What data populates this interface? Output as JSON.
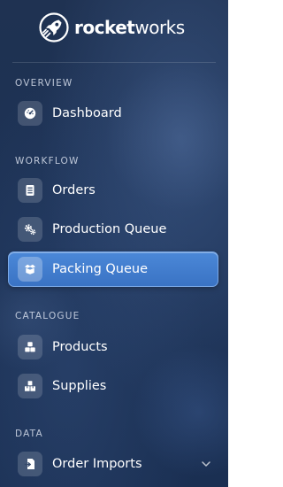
{
  "brand": {
    "name_bold": "rocket",
    "name_light": "works"
  },
  "sections": {
    "overview": {
      "label": "OVERVIEW",
      "items": [
        {
          "label": "Dashboard",
          "icon": "dashboard-gauge-icon"
        }
      ]
    },
    "workflow": {
      "label": "WORKFLOW",
      "items": [
        {
          "label": "Orders",
          "icon": "document-icon"
        },
        {
          "label": "Production Queue",
          "icon": "gears-icon"
        },
        {
          "label": "Packing Queue",
          "icon": "box-icon",
          "active": true
        }
      ]
    },
    "catalogue": {
      "label": "CATALOGUE",
      "items": [
        {
          "label": "Products",
          "icon": "cubes-icon"
        },
        {
          "label": "Supplies",
          "icon": "boxes-icon"
        }
      ]
    },
    "data": {
      "label": "DATA",
      "items": [
        {
          "label": "Order Imports",
          "icon": "file-import-icon",
          "expandable": true
        }
      ]
    }
  },
  "colors": {
    "background": "#1c3154",
    "active_item": "#4280d0",
    "text": "#ffffff"
  }
}
